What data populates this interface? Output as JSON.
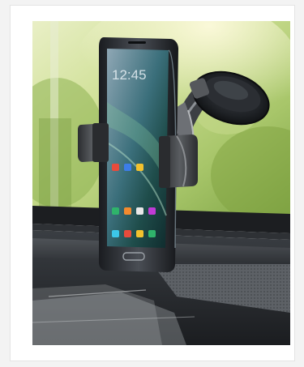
{
  "product_card": {
    "image": {
      "subject": "smartphone-car-mount-photo",
      "phone_screen_time": "12:45",
      "colors": {
        "background_foliage": "#a8c66a",
        "dashboard": "#2a2d31",
        "phone_body": "#26292e",
        "mount_grip": "#3b3d40",
        "suction_cup": "#1f2226"
      }
    }
  }
}
